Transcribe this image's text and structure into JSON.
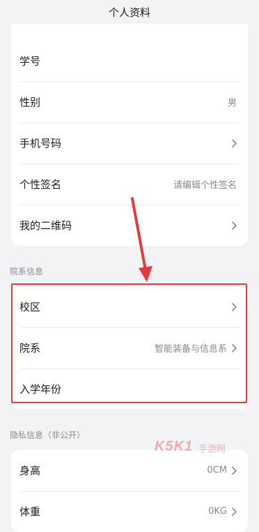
{
  "header": {
    "title": "个人资料"
  },
  "profile_card": {
    "rows": [
      {
        "label": "学号",
        "value": ""
      },
      {
        "label": "性别",
        "value": "男"
      },
      {
        "label": "手机号码",
        "value": ""
      },
      {
        "label": "个性签名",
        "value": "请编辑个性签名"
      },
      {
        "label": "我的二维码",
        "value": ""
      }
    ]
  },
  "school_section": {
    "title": "院系信息",
    "rows": [
      {
        "label": "校区",
        "value": ""
      },
      {
        "label": "院系",
        "value": "智能装备与信息系"
      },
      {
        "label": "入学年份",
        "value": ""
      }
    ]
  },
  "privacy_section": {
    "title": "隐私信息（非公开）",
    "rows": [
      {
        "label": "身高",
        "value": "0CM"
      },
      {
        "label": "体重",
        "value": "0KG"
      }
    ]
  },
  "watermark": {
    "brand": "K5K1",
    "sub": "手游网"
  },
  "colors": {
    "accent_annotation": "#e23b3b",
    "background": "#f2f3f5",
    "card": "#ffffff",
    "secondary_text": "#8a8a8e"
  }
}
